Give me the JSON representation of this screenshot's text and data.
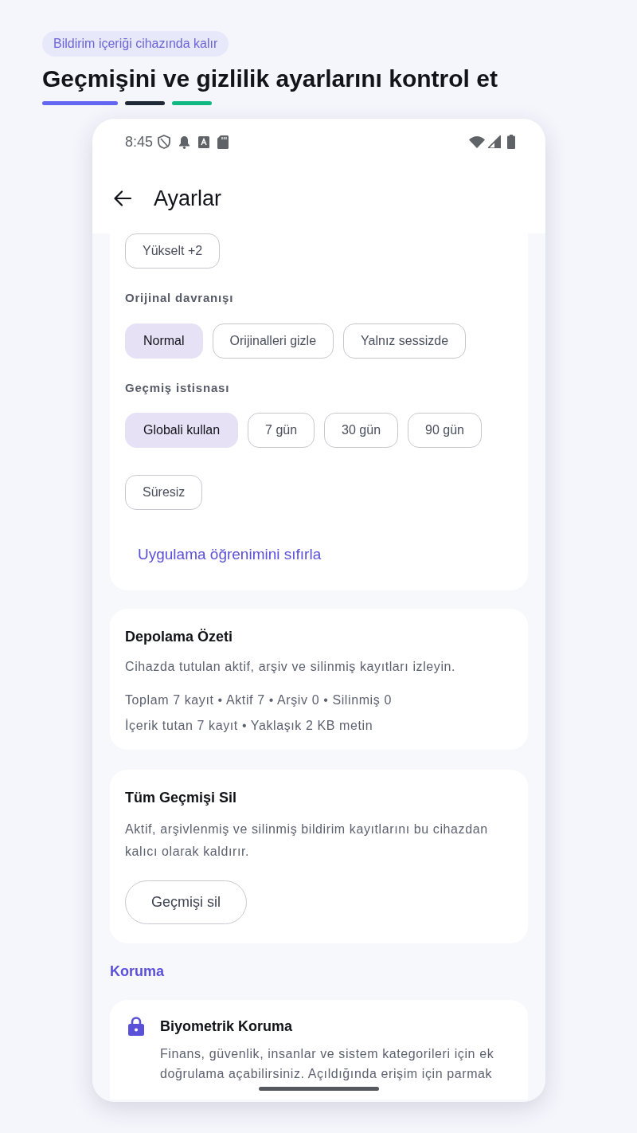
{
  "header": {
    "badge": "Bildirim içeriği cihazında kalır",
    "title": "Geçmişini ve gizlilik ayarlarını kontrol et",
    "accent_bars": [
      {
        "color": "#6366f1"
      },
      {
        "color": "#1f2937"
      },
      {
        "color": "#10b981"
      }
    ]
  },
  "status_bar": {
    "time": "8:45"
  },
  "app_bar": {
    "title": "Ayarlar"
  },
  "settings_card": {
    "groups": [
      {
        "options": [
          {
            "label": "Yükselt +2",
            "selected": false
          }
        ]
      },
      {
        "label": "Orijinal davranışı",
        "options": [
          {
            "label": "Normal",
            "selected": true
          },
          {
            "label": "Orijinalleri gizle",
            "selected": false
          },
          {
            "label": "Yalnız sessizde",
            "selected": false
          }
        ]
      },
      {
        "label": "Geçmiş istisnası",
        "options": [
          {
            "label": "Globali kullan",
            "selected": true
          },
          {
            "label": "7 gün",
            "selected": false
          },
          {
            "label": "30 gün",
            "selected": false
          },
          {
            "label": "90 gün",
            "selected": false
          },
          {
            "label": "Süresiz",
            "selected": false
          }
        ]
      }
    ],
    "link": "Uygulama öğrenimini sıfırla"
  },
  "storage_card": {
    "title": "Depolama Özeti",
    "description": "Cihazda tutulan aktif, arşiv ve silinmiş kayıtları izleyin.",
    "stats": [
      "Toplam 7 kayıt • Aktif 7 • Arşiv 0 • Silinmiş 0",
      "İçerik tutan 7 kayıt • Yaklaşık 2 KB metin"
    ]
  },
  "delete_card": {
    "title": "Tüm Geçmişi Sil",
    "description": "Aktif, arşivlenmiş ve silinmiş bildirim kayıtlarını bu cihazdan kalıcı olarak kaldırır.",
    "button": "Geçmişi sil"
  },
  "section_label": "Koruma",
  "biometric_card": {
    "title": "Biyometrik Koruma",
    "description": "Finans, güvenlik, insanlar ve sistem kategorileri için ek doğrulama açabilirsiniz. Açıldığında erişim için parmak"
  }
}
